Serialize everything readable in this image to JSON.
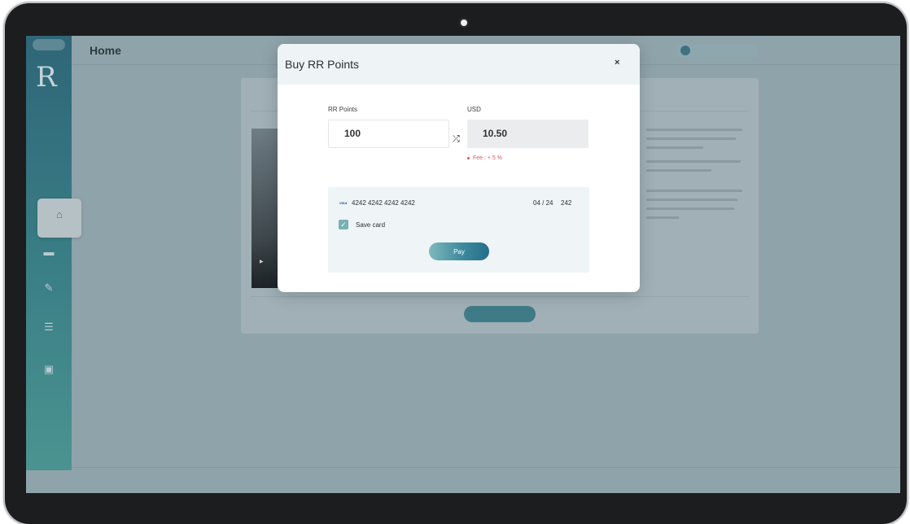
{
  "background_app": {
    "sidebar": {
      "logo": "R",
      "active_item_icon": "home-icon",
      "items": [
        {
          "icon": "home-icon"
        },
        {
          "icon": "folder-icon"
        },
        {
          "icon": "pencil-icon"
        },
        {
          "icon": "list-icon"
        },
        {
          "icon": "square-icon"
        }
      ]
    },
    "header": {
      "title": "Home"
    }
  },
  "modal": {
    "title": "Buy RR Points",
    "close_label": "×",
    "rr_points": {
      "label": "RR Points",
      "value": "100"
    },
    "usd": {
      "label": "USD",
      "value": "10.50"
    },
    "swap_icon": "swap-arrows-icon",
    "fee_text": "Fee : + 5 %",
    "payment": {
      "card_brand": "VISA",
      "card_number": "4242 4242 4242 4242",
      "expiry": "04 / 24",
      "cvc": "242",
      "save_card_label": "Save card",
      "save_card_checked": true,
      "pay_label": "Pay"
    }
  },
  "colors": {
    "overlay": "#8fa3ab",
    "sidebar": "#2f6678",
    "fee": "#e0545e",
    "pay_button_start": "#80b8bd",
    "pay_button_end": "#256d8c",
    "checkbox": "#7aafb3"
  }
}
